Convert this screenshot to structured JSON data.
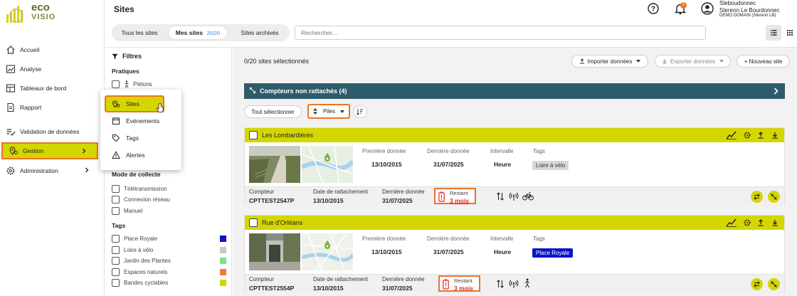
{
  "brand": {
    "line1": "eco",
    "line2": "VISIO"
  },
  "nav": {
    "items": [
      {
        "label": "Accueil",
        "icon": "home-icon"
      },
      {
        "label": "Analyse",
        "icon": "analysis-icon"
      },
      {
        "label": "Tableaux de bord",
        "icon": "dashboard-icon"
      },
      {
        "label": "Rapport",
        "icon": "report-icon"
      },
      {
        "label": "Validation de données",
        "icon": "validation-icon"
      },
      {
        "label": "Gestion",
        "icon": "map-pin-icon"
      },
      {
        "label": "Administration",
        "icon": "gear-icon"
      }
    ]
  },
  "header": {
    "title": "Sites",
    "user": {
      "login": "Sleboudonnec",
      "name": "Sterenn Le Bourdonnec",
      "domain": "DEMO DOMAIN (Sterenn LB)"
    },
    "notifications_count": "1"
  },
  "toolbar": {
    "tabs": [
      {
        "label": "Tous les sites"
      },
      {
        "label": "Mes sites",
        "count": "20/20"
      },
      {
        "label": "Sites archivés"
      }
    ],
    "search_placeholder": "Rechercher..."
  },
  "filters": {
    "title": "Filtres",
    "sections": {
      "pratiques": {
        "title": "Pratiques",
        "items": [
          "Piétons"
        ]
      },
      "mode": {
        "title": "Mode de collecte",
        "items": [
          "Télétransmission",
          "Connexion réseau",
          "Manuel"
        ]
      },
      "tags": {
        "title": "Tags",
        "items": [
          {
            "label": "Place Royale",
            "color": "#0a14c8"
          },
          {
            "label": "Loire à vélo",
            "color": "#c8c8c8"
          },
          {
            "label": "Jardin des Plantes",
            "color": "#7de08a"
          },
          {
            "label": "Espaces naturels",
            "color": "#f07a3a"
          },
          {
            "label": "Bandes cyclables",
            "color": "#d4d600"
          }
        ]
      }
    }
  },
  "gestion_menu": {
    "items": [
      {
        "label": "Sites",
        "icon": "map-pin-icon"
      },
      {
        "label": "Événements",
        "icon": "calendar-icon"
      },
      {
        "label": "Tags",
        "icon": "tag-icon"
      },
      {
        "label": "Alertes",
        "icon": "warning-icon"
      }
    ]
  },
  "main": {
    "selected_count": "0/20 sites sélectionnés",
    "import_label": "Importer données",
    "export_label": "Exporter données",
    "new_site_label": "+ Nouveau site",
    "banner": "Compteurs non rattachés (4)",
    "select_all": "Tout sélectionner",
    "sort_label": "Piles"
  },
  "sites": [
    {
      "name": "Les Lombardières",
      "first_data_label": "Première donnée",
      "first_data": "13/10/2015",
      "last_data_label": "Dernière donnée",
      "last_data": "31/07/2025",
      "interval_label": "Intervalle",
      "interval": "Heure",
      "tags_label": "Tags",
      "tag": "Loire à vélo",
      "tag_color": "#d8d8d8",
      "tag_text_color": "#333333",
      "counter_label": "Compteur",
      "counter": "CPTTEST2547P",
      "attach_label": "Date de rattachement",
      "attach_date": "13/10/2015",
      "last_label": "Dernière donnée",
      "last": "31/07/2025",
      "remaining_label": "Restant",
      "remaining": "3 mois",
      "practice_icon": "bike-icon"
    },
    {
      "name": "Rue d'Orléans",
      "first_data_label": "Première donnée",
      "first_data": "13/10/2015",
      "last_data_label": "Dernière donnée",
      "last_data": "31/07/2025",
      "interval_label": "Intervalle",
      "interval": "Heure",
      "tags_label": "Tags",
      "tag": "Place Royale",
      "tag_color": "#0a14c8",
      "tag_text_color": "#ffffff",
      "counter_label": "Compteur",
      "counter": "CPTTEST2554P",
      "attach_label": "Date de rattachement",
      "attach_date": "13/10/2015",
      "last_label": "Dernière donnée",
      "last": "31/07/2025",
      "remaining_label": "Restant",
      "remaining": "3 mois",
      "practice_icon": "pedestrian-icon"
    }
  ],
  "colors": {
    "accent": "#d4d600",
    "highlight_border": "#e8742a",
    "banner": "#2e5b6b",
    "remaining": "#d92b2b"
  }
}
